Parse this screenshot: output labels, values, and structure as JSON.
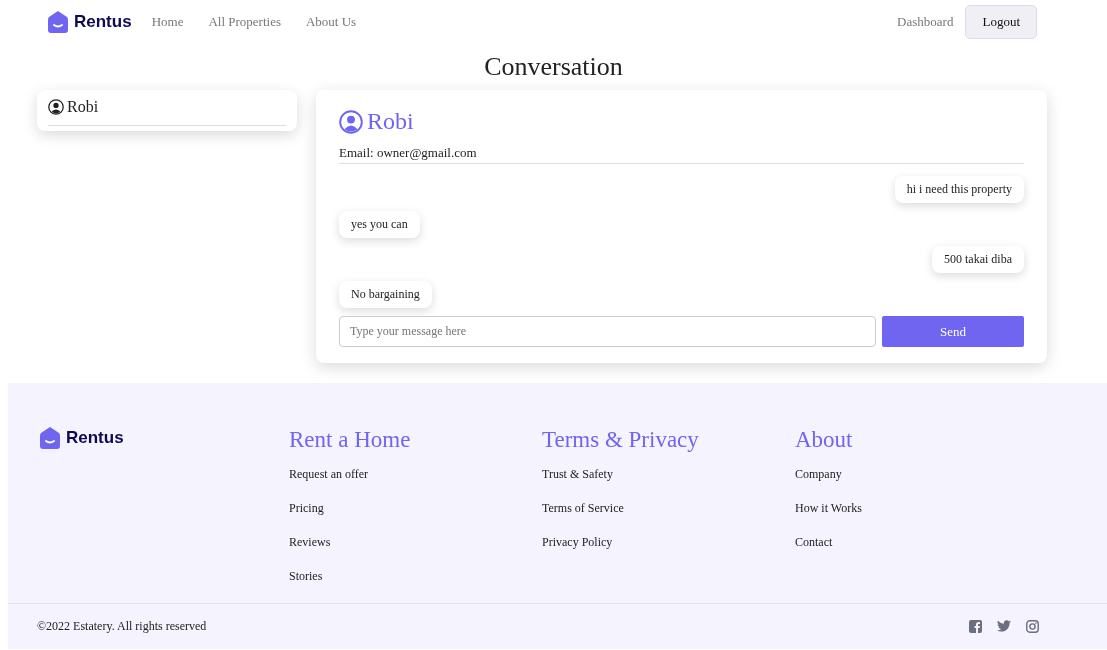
{
  "nav": {
    "brand": "Rentus",
    "links": [
      "Home",
      "All Properties",
      "About Us"
    ],
    "dashboard": "Dashboard",
    "logout": "Logout"
  },
  "page_title": "Conversation",
  "contacts": [
    {
      "name": "Robi"
    }
  ],
  "chat": {
    "name": "Robi",
    "email": "Email: owner@gmail.com",
    "messages": [
      {
        "kind": "sent",
        "text": "hi i need this property"
      },
      {
        "kind": "received",
        "text": "yes you can"
      },
      {
        "kind": "sent",
        "text": "500 takai diba"
      },
      {
        "kind": "received",
        "text": "No bargaining"
      }
    ],
    "input": {
      "placeholder": "Type your message here"
    },
    "send": "Send"
  },
  "footer": {
    "brand": "Rentus",
    "columns": [
      {
        "title": "Rent a Home",
        "links": [
          "Request an offer",
          "Pricing",
          "Reviews",
          "Stories"
        ]
      },
      {
        "title": "Terms & Privacy",
        "links": [
          "Trust & Safety",
          "Terms of Service",
          "Privacy Policy"
        ]
      },
      {
        "title": "About",
        "links": [
          "Company",
          "How it Works",
          "Contact"
        ]
      }
    ],
    "copyright": "©2022 Estatery. All rights reserved"
  }
}
